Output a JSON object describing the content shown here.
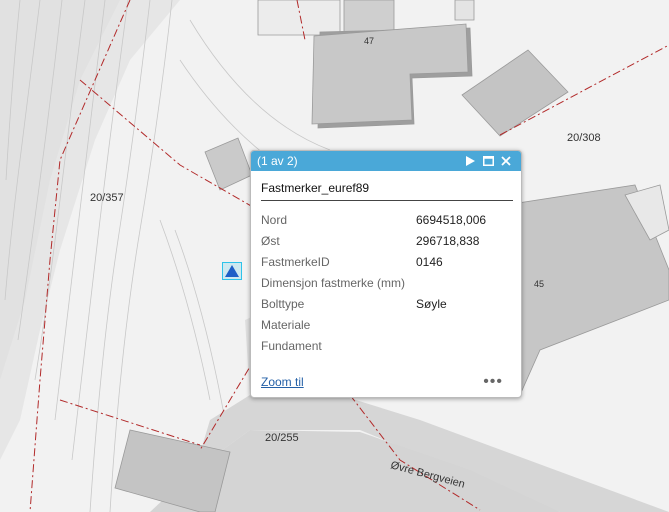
{
  "map": {
    "parcels": [
      {
        "id": "p1",
        "label": "20/357"
      },
      {
        "id": "p2",
        "label": "20/308"
      },
      {
        "id": "p3",
        "label": "20/255"
      }
    ],
    "house_numbers": [
      {
        "id": "h47",
        "label": "47"
      },
      {
        "id": "h45",
        "label": "45"
      }
    ],
    "road_name": "Øvre Bergveien",
    "marker_icon": "triangle-marker-icon",
    "colors": {
      "parcel_line": "#b22a2a",
      "road": "#d6d6d6",
      "building": "#c9c9c9",
      "highlight": "#2ec3ea",
      "marker": "#1e5fc7",
      "header": "#4aa8d8"
    }
  },
  "popup": {
    "counter": "(1 av 2)",
    "title": "Fastmerker_euref89",
    "fields": [
      {
        "key": "Nord",
        "value": "6694518,006"
      },
      {
        "key": "Øst",
        "value": "296718,838"
      },
      {
        "key": "FastmerkeID",
        "value": "0146"
      },
      {
        "key": "Dimensjon fastmerke (mm)",
        "value": ""
      },
      {
        "key": "Bolttype",
        "value": "Søyle"
      },
      {
        "key": "Materiale",
        "value": ""
      },
      {
        "key": "Fundament",
        "value": ""
      }
    ],
    "zoom_label": "Zoom til",
    "more_label": "•••",
    "icons": [
      "play-icon",
      "maximize-icon",
      "close-icon",
      "more-icon"
    ]
  }
}
